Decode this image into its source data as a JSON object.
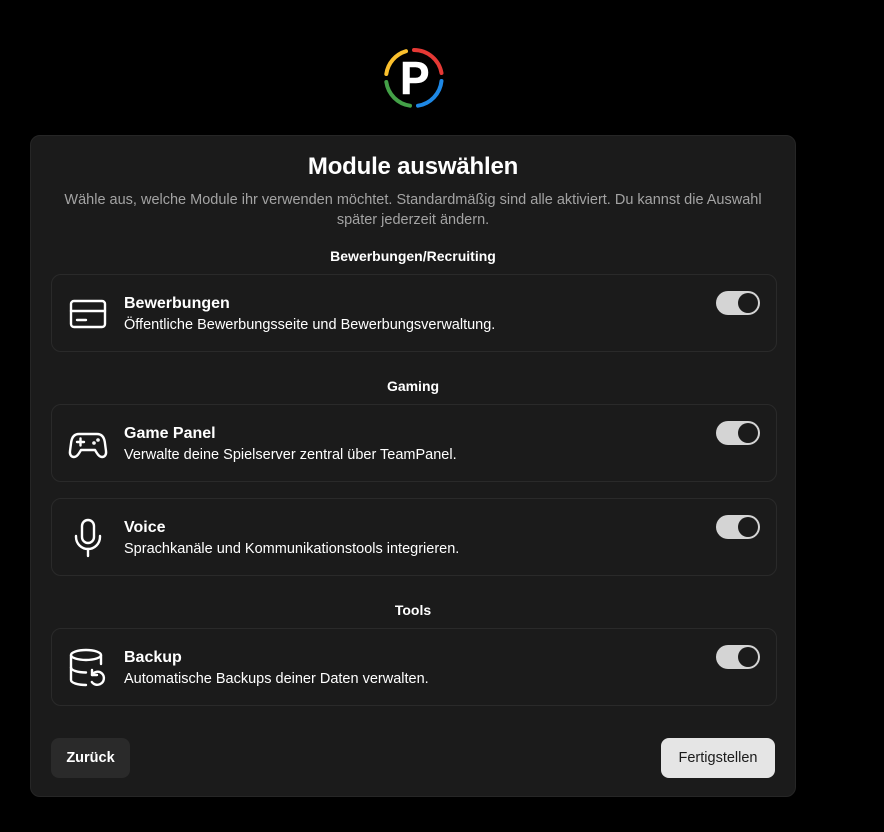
{
  "logo": {
    "letter": "P",
    "ring_colors": [
      "#e53935",
      "#fbc02d",
      "#43a047",
      "#1e88e5"
    ]
  },
  "header": {
    "title": "Module auswählen",
    "subtitle": "Wähle aus, welche Module ihr verwenden möchtet. Standardmäßig sind alle aktiviert. Du kannst die Auswahl später jederzeit ändern."
  },
  "sections": [
    {
      "title": "Bewerbungen/Recruiting",
      "modules": [
        {
          "icon": "credit-card-icon",
          "name": "Bewerbungen",
          "description": "Öffentliche Bewerbungsseite und Bewerbungsverwaltung.",
          "enabled": true
        }
      ]
    },
    {
      "title": "Gaming",
      "modules": [
        {
          "icon": "gamepad-icon",
          "name": "Game Panel",
          "description": "Verwalte deine Spielserver zentral über TeamPanel.",
          "enabled": true
        },
        {
          "icon": "microphone-icon",
          "name": "Voice",
          "description": "Sprachkanäle und Kommunikationstools integrieren.",
          "enabled": true
        }
      ]
    },
    {
      "title": "Tools",
      "modules": [
        {
          "icon": "database-backup-icon",
          "name": "Backup",
          "description": "Automatische Backups deiner Daten verwalten.",
          "enabled": true
        }
      ]
    }
  ],
  "footer": {
    "back_label": "Zurück",
    "finish_label": "Fertigstellen"
  }
}
